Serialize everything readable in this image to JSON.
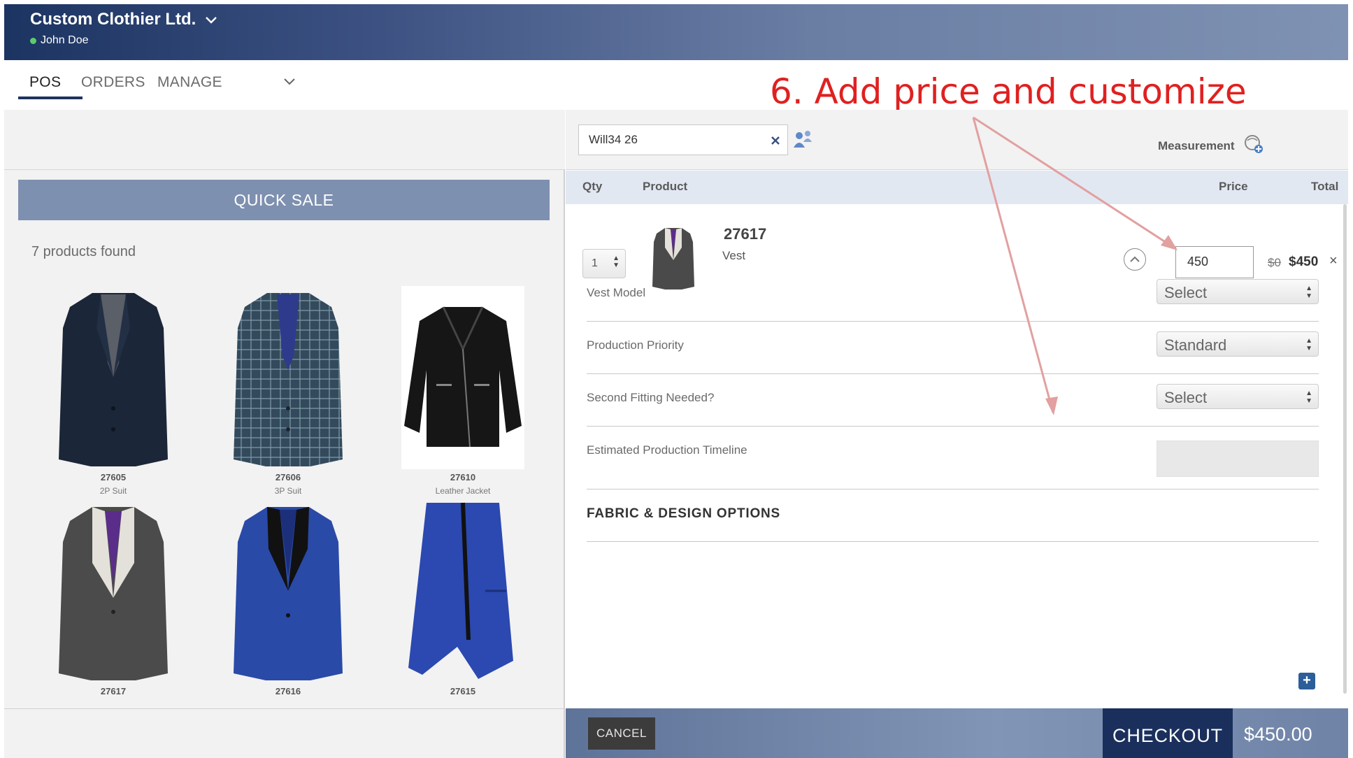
{
  "header": {
    "company": "Custom Clothier Ltd.",
    "user": "John Doe"
  },
  "nav": {
    "tabs": [
      "POS",
      "ORDERS",
      "MANAGE"
    ]
  },
  "annotation": {
    "number": "6",
    "text": ". Add price and customize"
  },
  "left": {
    "quick_sale": "QUICK SALE",
    "found_text": "7 products found",
    "products": [
      {
        "code": "27605",
        "type": "2P Suit"
      },
      {
        "code": "27606",
        "type": "3P Suit"
      },
      {
        "code": "27610",
        "type": "Leather Jacket"
      },
      {
        "code": "27617",
        "type": ""
      },
      {
        "code": "27616",
        "type": ""
      },
      {
        "code": "27615",
        "type": ""
      }
    ]
  },
  "right": {
    "search_value": "Will34 26",
    "measurement_label": "Measurement",
    "columns": {
      "qty": "Qty",
      "product": "Product",
      "price": "Price",
      "total": "Total"
    },
    "item": {
      "qty": "1",
      "code": "27617",
      "name": "Vest",
      "price_value": "450",
      "old_price": "$0",
      "total": "$450"
    },
    "options": [
      {
        "label": "Vest Model",
        "value": "Select"
      },
      {
        "label": "Production Priority",
        "value": "Standard"
      },
      {
        "label": "Second Fitting Needed?",
        "value": "Select"
      },
      {
        "label": "Estimated Production Timeline",
        "value": ""
      }
    ],
    "fabric_title": "FABRIC & DESIGN OPTIONS"
  },
  "footer": {
    "cancel": "CANCEL",
    "checkout": "CHECKOUT",
    "grand_total": "$450.00"
  },
  "colors": {
    "header_dark": "#1c3462",
    "accent": "#7e90b0",
    "checkout": "#1a2f5c",
    "annotation": "#e02020"
  },
  "icons": [
    "chevron-down-icon",
    "status-dot-icon",
    "clear-icon",
    "customer-switch-icon",
    "measurement-icon",
    "collapse-icon",
    "remove-icon",
    "add-icon"
  ]
}
